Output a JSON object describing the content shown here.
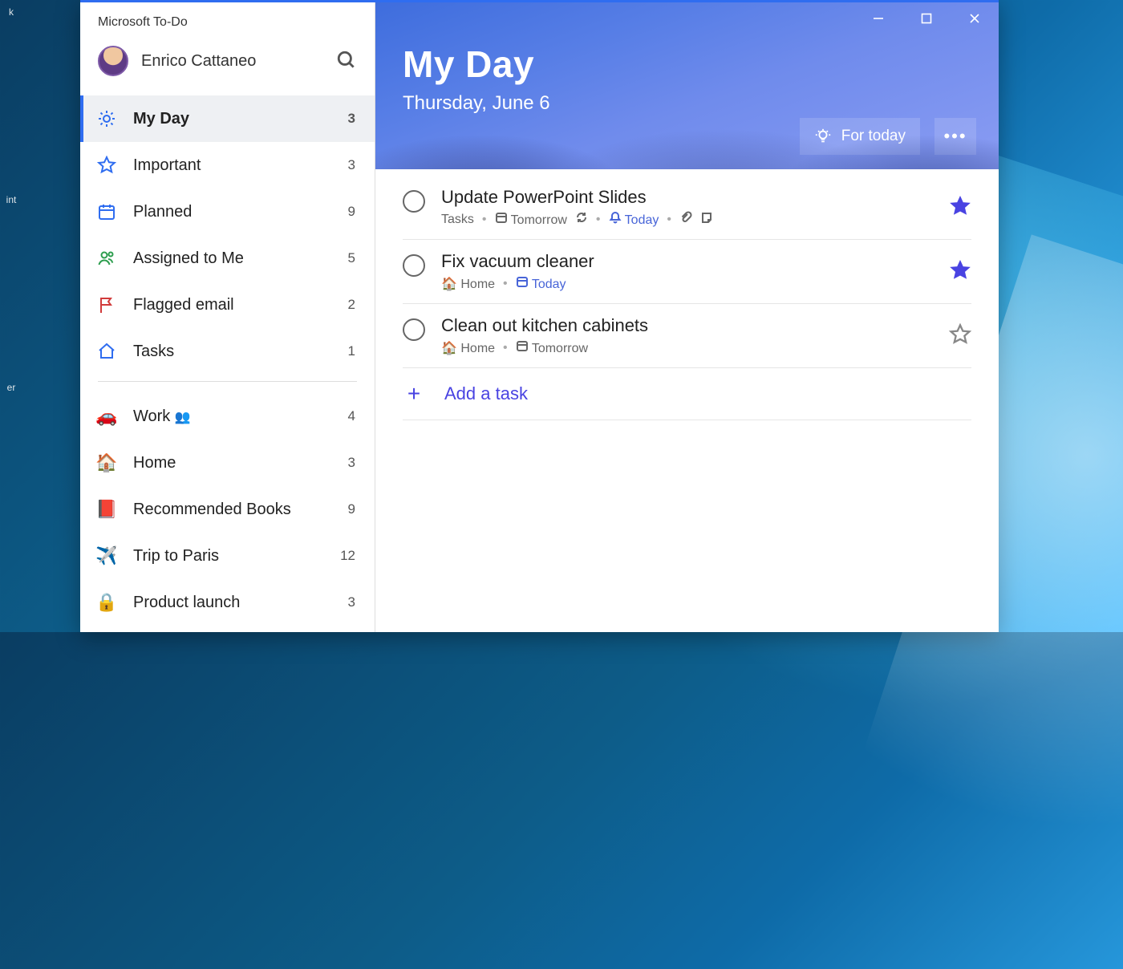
{
  "app_title": "Microsoft To-Do",
  "user_name": "Enrico Cattaneo",
  "sidebar": {
    "smart": [
      {
        "id": "myday",
        "label": "My Day",
        "count": 3,
        "active": true
      },
      {
        "id": "important",
        "label": "Important",
        "count": 3
      },
      {
        "id": "planned",
        "label": "Planned",
        "count": 9
      },
      {
        "id": "assigned",
        "label": "Assigned to Me",
        "count": 5
      },
      {
        "id": "flagged",
        "label": "Flagged email",
        "count": 2
      },
      {
        "id": "tasks",
        "label": "Tasks",
        "count": 1
      }
    ],
    "lists": [
      {
        "id": "work",
        "emoji": "🚗",
        "label": "Work",
        "count": 4,
        "shared": true
      },
      {
        "id": "home",
        "emoji": "🏠",
        "label": "Home",
        "count": 3
      },
      {
        "id": "books",
        "emoji": "📕",
        "label": "Recommended Books",
        "count": 9
      },
      {
        "id": "paris",
        "emoji": "✈️",
        "label": "Trip to Paris",
        "count": 12
      },
      {
        "id": "launch",
        "emoji": "🔒",
        "label": "Product launch",
        "count": 3
      }
    ]
  },
  "header": {
    "title": "My Day",
    "date": "Thursday, June 6",
    "suggestions_label": "For today"
  },
  "tasks": [
    {
      "title": "Update PowerPoint Slides",
      "list": "Tasks",
      "list_emoji": "",
      "due": "Tomorrow",
      "due_accent": false,
      "repeat": true,
      "reminder": "Today",
      "has_attachment": true,
      "has_note": true,
      "starred": true
    },
    {
      "title": "Fix vacuum cleaner",
      "list": "Home",
      "list_emoji": "🏠",
      "due": "Today",
      "due_accent": true,
      "repeat": false,
      "reminder": "",
      "has_attachment": false,
      "has_note": false,
      "starred": true
    },
    {
      "title": "Clean out kitchen cabinets",
      "list": "Home",
      "list_emoji": "🏠",
      "due": "Tomorrow",
      "due_accent": false,
      "repeat": false,
      "reminder": "",
      "has_attachment": false,
      "has_note": false,
      "starred": false
    }
  ],
  "add_task_label": "Add a task",
  "desktop_labels": [
    "k",
    "",
    "int",
    "",
    "er"
  ]
}
